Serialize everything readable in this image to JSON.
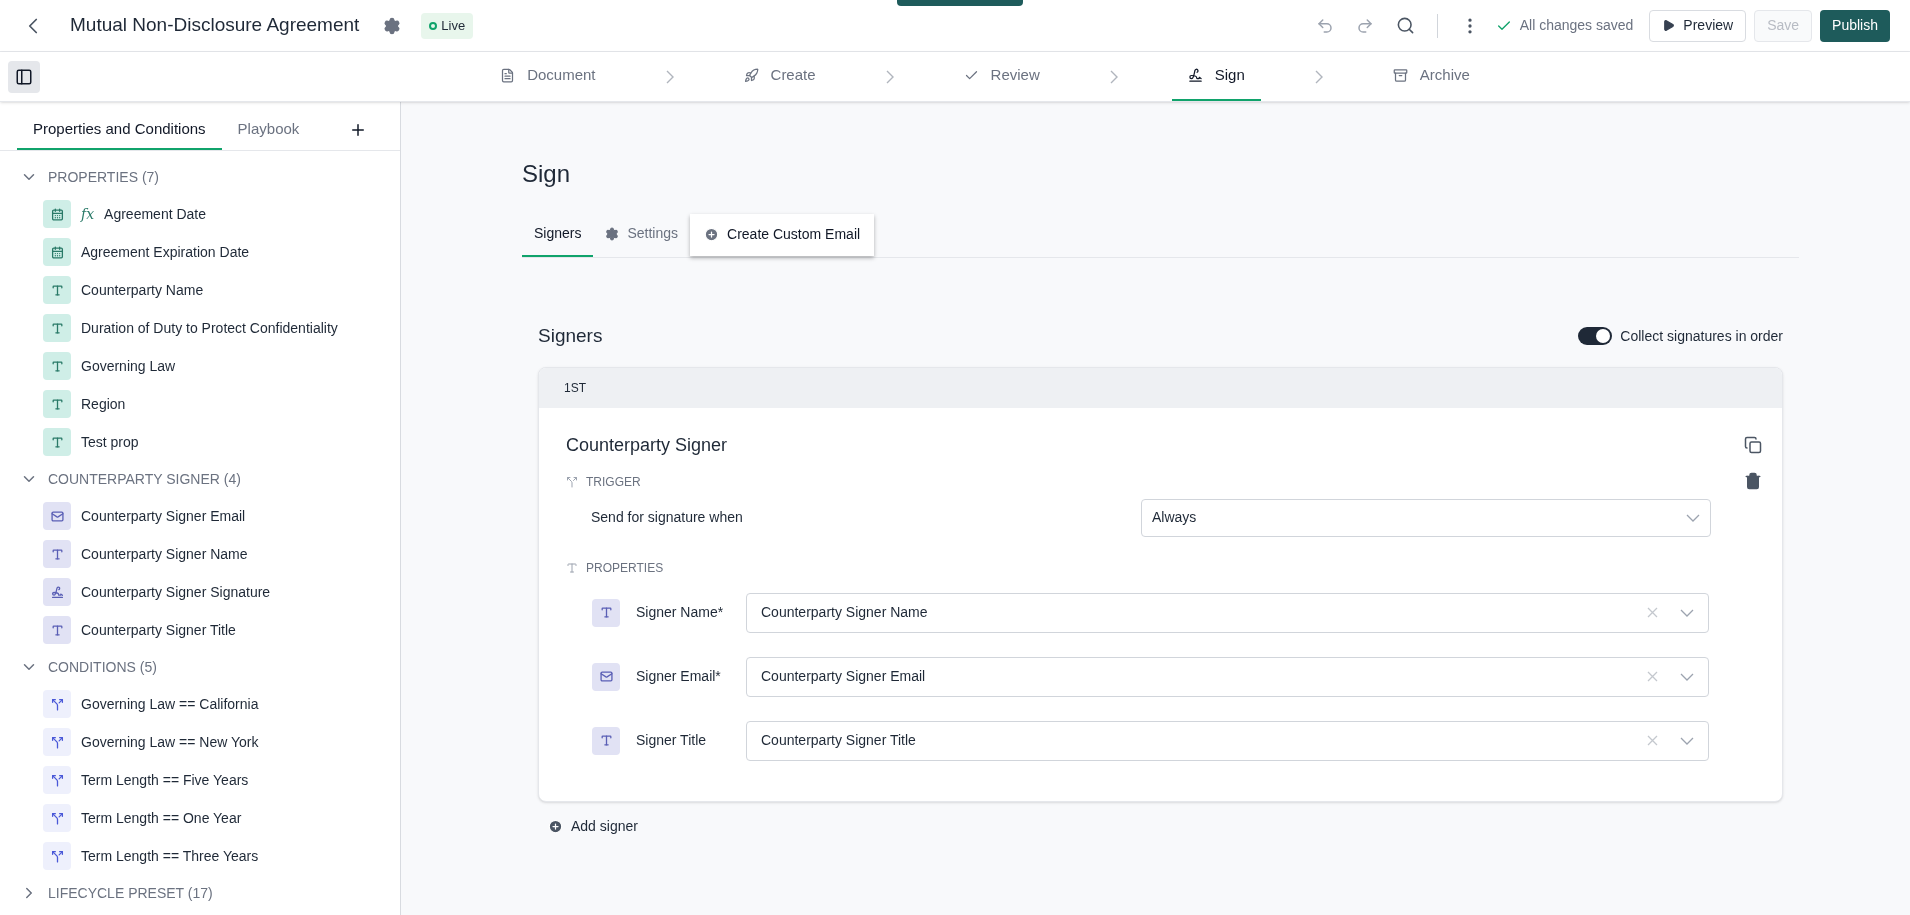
{
  "header": {
    "title": "Mutual Non-Disclosure Agreement",
    "status": "Live",
    "save_status": "All changes saved",
    "buttons": [
      {
        "label": "Preview",
        "kind": "preview",
        "disabled": false
      },
      {
        "label": "Save",
        "kind": "save",
        "disabled": true
      },
      {
        "label": "Publish",
        "kind": "publish",
        "disabled": false
      }
    ]
  },
  "steps": [
    {
      "label": "Document",
      "kind": "document",
      "selected": false
    },
    {
      "label": "Create",
      "kind": "create",
      "selected": false
    },
    {
      "label": "Review",
      "kind": "review",
      "selected": false
    },
    {
      "label": "Sign",
      "kind": "sign",
      "selected": true
    },
    {
      "label": "Archive",
      "kind": "archive",
      "selected": false
    }
  ],
  "sidebar": {
    "tabs": [
      {
        "label": "Properties and Conditions",
        "selected": true
      },
      {
        "label": "Playbook",
        "selected": false
      }
    ],
    "sections": [
      {
        "title": "PROPERTIES (7)",
        "kind": "property",
        "expanded": true,
        "items": [
          {
            "label": "Agreement Date",
            "kind": "date",
            "badge": "fx"
          },
          {
            "label": "Agreement Expiration Date",
            "kind": "date"
          },
          {
            "label": "Counterparty Name",
            "kind": "text"
          },
          {
            "label": "Duration of Duty to Protect Confidentiality",
            "kind": "text"
          },
          {
            "label": "Governing Law",
            "kind": "text"
          },
          {
            "label": "Region",
            "kind": "text"
          },
          {
            "label": "Test prop",
            "kind": "text"
          }
        ]
      },
      {
        "title": "COUNTERPARTY SIGNER (4)",
        "kind": "signer",
        "expanded": true,
        "items": [
          {
            "label": "Counterparty Signer Email",
            "kind": "email"
          },
          {
            "label": "Counterparty Signer Name",
            "kind": "text"
          },
          {
            "label": "Counterparty Signer Signature",
            "kind": "signature"
          },
          {
            "label": "Counterparty Signer Title",
            "kind": "text"
          }
        ]
      },
      {
        "title": "CONDITIONS (5)",
        "kind": "condition",
        "expanded": true,
        "items": [
          {
            "label": "Governing Law == California",
            "kind": "condition"
          },
          {
            "label": "Governing Law == New York",
            "kind": "condition"
          },
          {
            "label": "Term Length == Five Years",
            "kind": "condition"
          },
          {
            "label": "Term Length == One Year",
            "kind": "condition"
          },
          {
            "label": "Term Length == Three Years",
            "kind": "condition"
          }
        ]
      },
      {
        "title": "LIFECYCLE PRESET (17)",
        "kind": "preset",
        "expanded": false
      }
    ]
  },
  "main": {
    "title": "Sign",
    "tabs": [
      {
        "label": "Signers",
        "kind": "plain",
        "selected": true,
        "highlighted": false
      },
      {
        "label": "Settings",
        "kind": "settings",
        "selected": false,
        "highlighted": false
      },
      {
        "label": "Create Custom Email",
        "kind": "add",
        "selected": false,
        "highlighted": true
      }
    ],
    "signers_heading": "Signers",
    "order_toggle": {
      "label": "Collect signatures in order",
      "on": true
    },
    "signer": {
      "order": "1ST",
      "name": "Counterparty Signer",
      "trigger_heading": "TRIGGER",
      "trigger_label": "Send for signature when",
      "trigger_value": "Always",
      "properties_heading": "PROPERTIES",
      "fields": [
        {
          "label": "Signer Name*",
          "kind": "text",
          "value": "Counterparty Signer Name"
        },
        {
          "label": "Signer Email*",
          "kind": "email",
          "value": "Counterparty Signer Email"
        },
        {
          "label": "Signer Title",
          "kind": "text",
          "value": "Counterparty Signer Title"
        }
      ]
    },
    "add_signer": "Add signer"
  }
}
